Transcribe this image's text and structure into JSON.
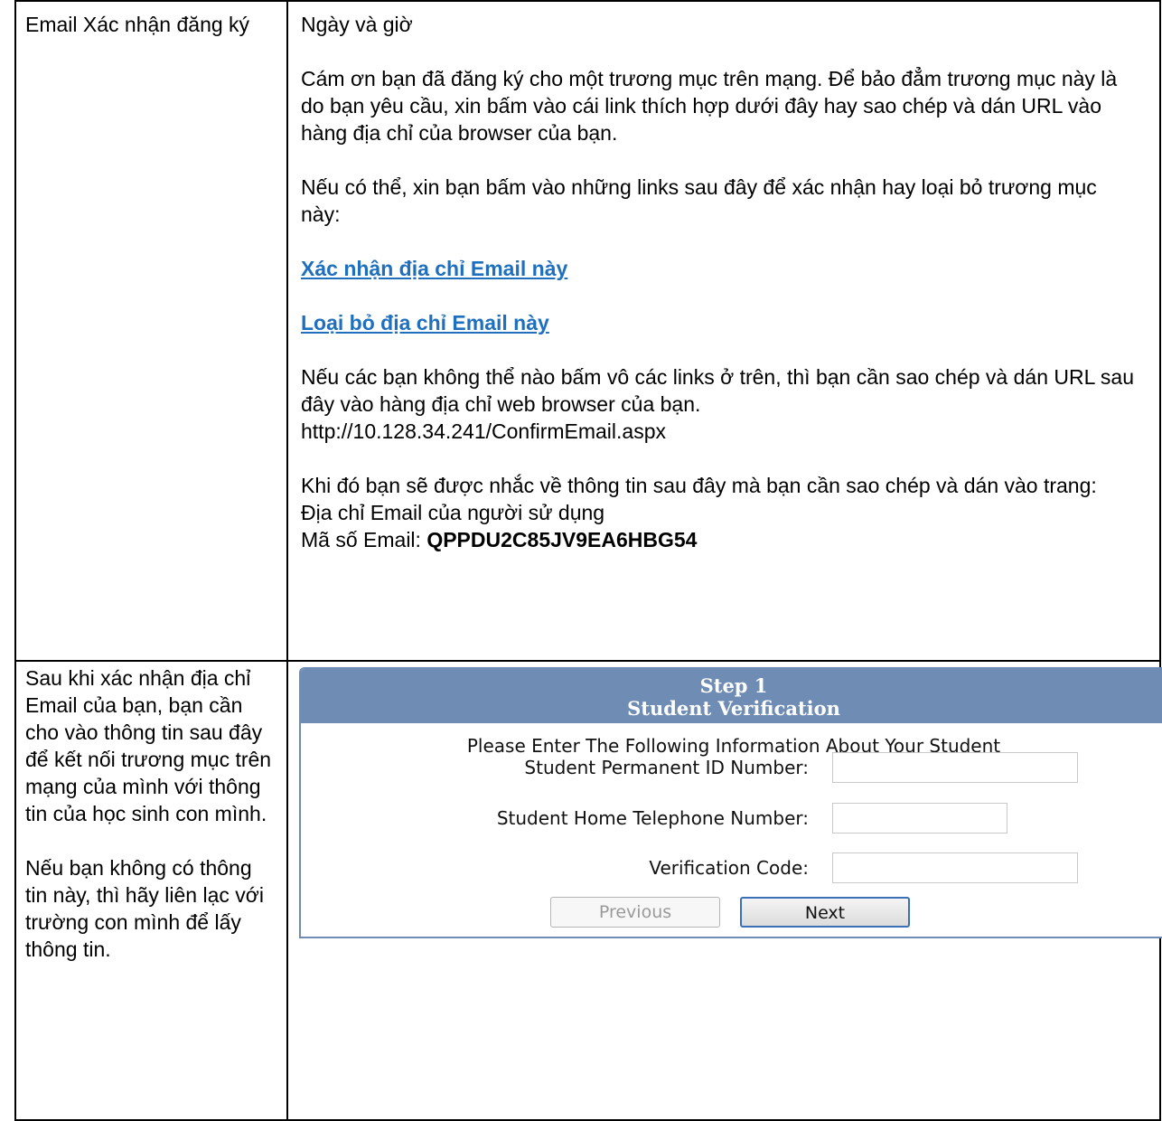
{
  "row1": {
    "left_label": "Email Xác nhận đăng ký",
    "date_time": "Ngày và giờ",
    "para1": "Cám ơn bạn đã đăng ký cho một trương mục trên mạng. Để bảo đẳm trương mục này là do bạn yêu cầu, xin bấm vào cái link thích hợp dưới đây hay sao chép và dán URL vào hàng địa chỉ của browser của bạn.",
    "para2": "Nếu có thể, xin bạn bấm vào những links sau đây để xác nhận hay loại bỏ trương mục này:",
    "link_confirm": "Xác nhận địa chỉ Email này",
    "link_remove": "Loại bỏ địa chỉ Email này",
    "para3": "Nếu các bạn không thể nào bấm vô các links ở trên, thì bạn cần sao chép và dán URL sau đây vào hàng địa chỉ web browser của bạn.",
    "url": "http://10.128.34.241/ConfirmEmail.aspx",
    "para4": "Khi đó bạn sẽ được nhắc về thông tin sau đây mà bạn cần sao chép và dán vào trang:",
    "email_line": "Địa chỉ Email của người sử dụng",
    "code_label": "Mã số Email: ",
    "code_value": "QPPDU2C85JV9EA6HBG54"
  },
  "row2": {
    "left_para1": "Sau khi xác nhận địa chỉ Email của bạn, bạn cần cho vào thông tin sau đây để kết nối trương mục trên mạng của mình với thông tin của học sinh con mình.",
    "left_para2": "Nếu bạn không có thông tin này, thì hãy liên lạc với trường con mình để lấy thông tin.",
    "panel": {
      "step": "Step 1",
      "title": "Student Verification",
      "subtitle": "Please Enter The Following Information About Your Student",
      "fields": [
        {
          "label": "Student Permanent ID Number:",
          "value": ""
        },
        {
          "label": "Student Home Telephone Number:",
          "value": ""
        },
        {
          "label": "Verification Code:",
          "value": ""
        }
      ],
      "previous_label": "Previous",
      "next_label": "Next"
    }
  },
  "colors": {
    "link": "#1f6fbf",
    "panel_header": "#6f8db4",
    "border": "#000000"
  }
}
